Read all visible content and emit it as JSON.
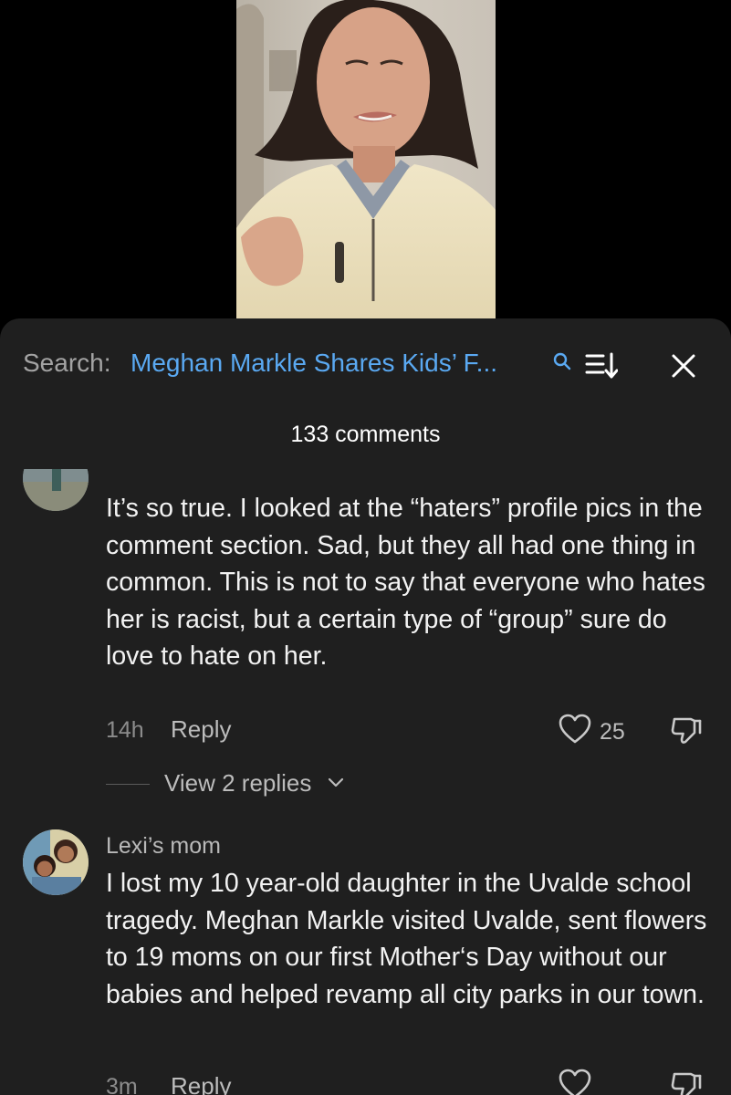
{
  "search": {
    "label": "Search:",
    "query": "Meghan Markle Shares Kids’ F..."
  },
  "comments_header": {
    "count_text": "133 comments"
  },
  "comments": [
    {
      "text": "It’s so true. I looked at the “haters” profile pics in the comment section. Sad, but they all had one thing in common. This is not to say that everyone who hates her is racist, but a certain type of “group” sure do love to hate on her.",
      "time": "14h",
      "reply_label": "Reply",
      "likes": "25",
      "view_replies": "View 2 replies"
    },
    {
      "author": "Lexi’s mom",
      "text": "I lost my 10 year-old daughter in the Uvalde school tragedy. Meghan Markle visited Uvalde, sent flowers to 19 moms on our first Mother‘s Day without our babies and helped revamp all city parks in our town.",
      "time": "3m",
      "reply_label": "Reply"
    }
  ],
  "icons": {
    "search": "search-icon",
    "sort": "sort-icon",
    "close": "close-icon",
    "like": "heart-icon",
    "dislike": "thumbs-down-icon",
    "expand": "chevron-down-icon"
  },
  "colors": {
    "sheet_background": "#1f1f1f",
    "search_query": "#5aa9f2",
    "text_primary": "#f2f2f2",
    "text_secondary": "#8c8c8c"
  }
}
